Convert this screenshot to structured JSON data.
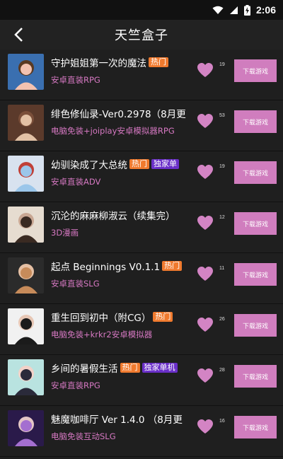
{
  "status": {
    "time": "2:06"
  },
  "header": {
    "title": "天竺盒子"
  },
  "colors": {
    "tag_hot": "#f07a2e",
    "tag_exclusive": "#6a2fc9",
    "subtitle": "#d678c2",
    "button": "#d07dbe",
    "heart": "#d384c4"
  },
  "items": [
    {
      "title": "守护姐姐第一次的魔法",
      "tags": [
        "热门"
      ],
      "subtitle": "安卓直装RPG",
      "likes": "19",
      "button": "下载游戏",
      "thumb": [
        "#3a6fb0",
        "#f3c2b0",
        "#5a3a22"
      ]
    },
    {
      "title": "绯色修仙录-Ver0.2978（8月更",
      "tags": [],
      "subtitle": "电脑免装+joiplay安卓模拟器RPG",
      "likes": "53",
      "button": "下载游戏",
      "thumb": [
        "#5b3a2b",
        "#e2c1a5",
        "#7a4f3a"
      ]
    },
    {
      "title": "幼驯染成了大总统",
      "tags": [
        "热门",
        "独家单"
      ],
      "subtitle": "安卓直装ADV",
      "likes": "19",
      "button": "下载游戏",
      "thumb": [
        "#d8e2ef",
        "#9bc6ea",
        "#c04038"
      ]
    },
    {
      "title": "沉沦的麻麻柳淑云（续集完）",
      "tags": [],
      "subtitle": "3D漫画",
      "likes": "12",
      "button": "下载游戏",
      "thumb": [
        "#e6dcd0",
        "#3a2a22",
        "#c9a793"
      ]
    },
    {
      "title": "起点 Beginnings V0.1.1",
      "tags": [
        "热门"
      ],
      "subtitle": "安卓直装SLG",
      "likes": "11",
      "button": "下载游戏",
      "thumb": [
        "#2b2b2b",
        "#c78b5a",
        "#e5c0a4"
      ]
    },
    {
      "title": "重生回到初中（附CG）",
      "tags": [
        "热门"
      ],
      "subtitle": "电脑免装+krkr2安卓模拟器",
      "likes": "26",
      "button": "下载游戏",
      "thumb": [
        "#f1f1f1",
        "#1b1b1b",
        "#e7c7b5"
      ]
    },
    {
      "title": "乡间的暑假生活",
      "tags": [
        "热门",
        "独家单机"
      ],
      "subtitle": "安卓直装RPG",
      "likes": "28",
      "button": "下载游戏",
      "thumb": [
        "#b9e3e0",
        "#2a2a3a",
        "#f2d2c8"
      ]
    },
    {
      "title": "魅魔咖啡厅 Ver 1.4.0 （8月更",
      "tags": [],
      "subtitle": "电脑免装互动SLG",
      "likes": "16",
      "button": "下载游戏",
      "thumb": [
        "#2a1a4a",
        "#a46fd0",
        "#e4c6c6"
      ]
    }
  ]
}
